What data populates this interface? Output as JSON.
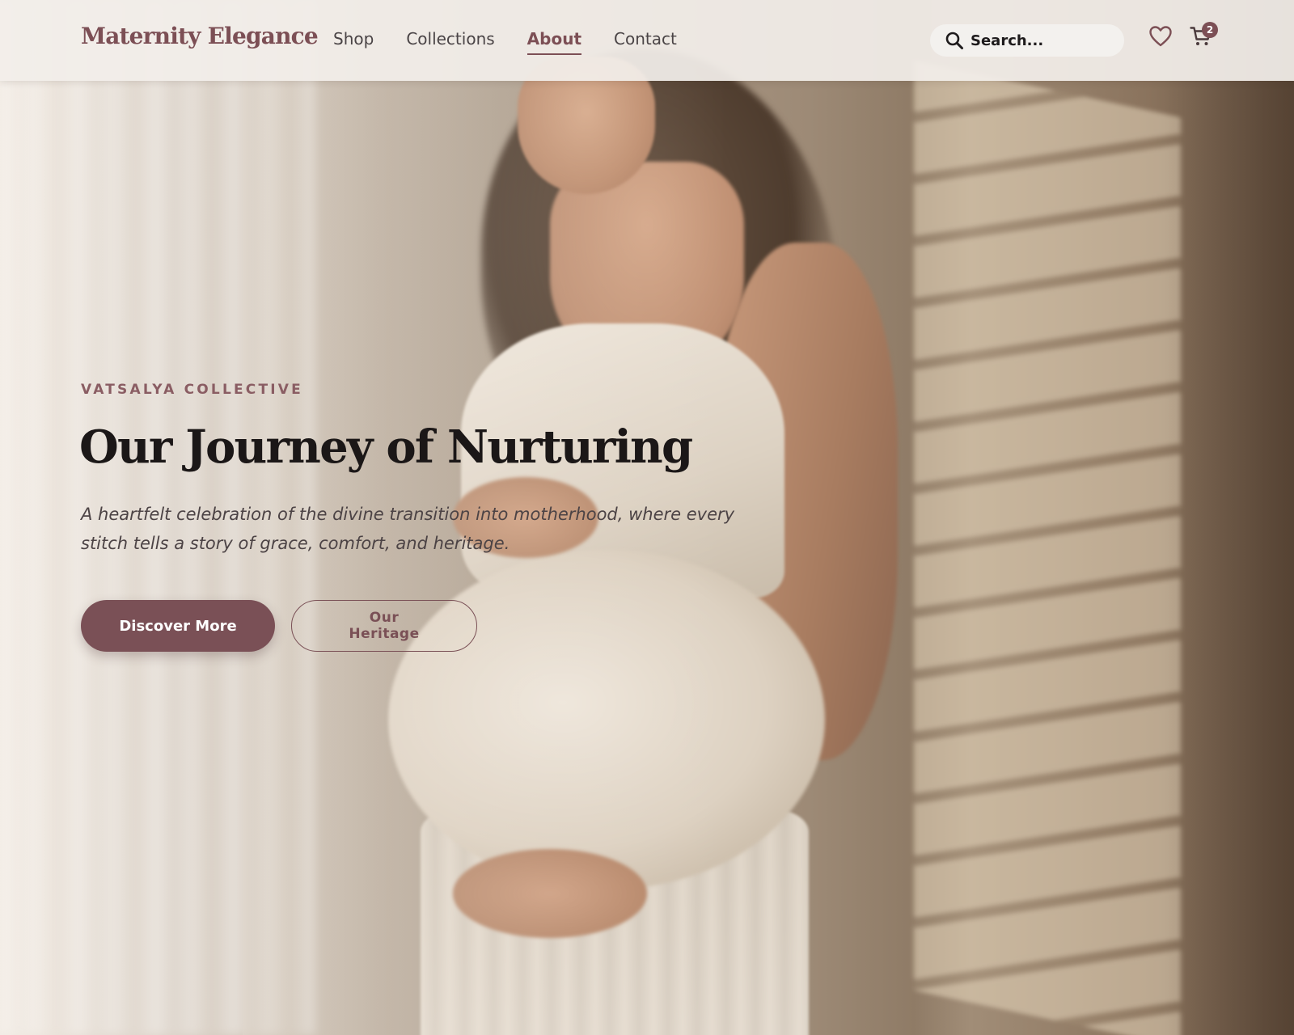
{
  "brand": {
    "name": "Maternity Elegance",
    "color": "#7c4f55"
  },
  "nav": {
    "items": [
      {
        "label": "Shop",
        "active": false
      },
      {
        "label": "Collections",
        "active": false
      },
      {
        "label": "About",
        "active": true
      },
      {
        "label": "Contact",
        "active": false
      }
    ]
  },
  "search": {
    "placeholder": "Search...",
    "icon": "search-icon"
  },
  "actions": {
    "wishlist_icon": "heart-icon",
    "cart_icon": "cart-icon",
    "cart_count": "2"
  },
  "hero": {
    "eyebrow": "VATSALYA COLLECTIVE",
    "title": "Our Journey of Nurturing",
    "subtitle": "A heartfelt celebration of the divine transition into motherhood, where every stitch tells a story of grace, comfort, and heritage.",
    "primary_button": "Discover More",
    "secondary_button": "Our Heritage"
  },
  "colors": {
    "accent": "#7a5056",
    "title_text": "#1b1717",
    "nav_text": "#4a4446"
  }
}
